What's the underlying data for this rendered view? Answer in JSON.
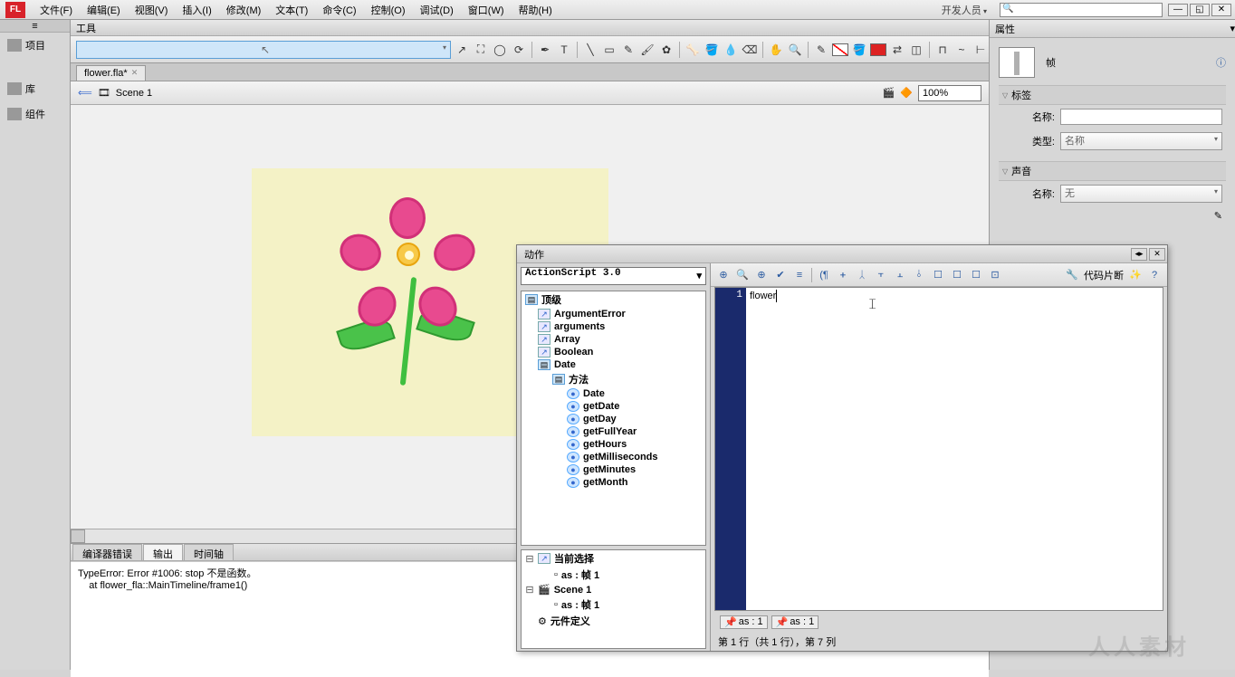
{
  "app": {
    "logo": "FL"
  },
  "menu": {
    "items": [
      "文件(F)",
      "编辑(E)",
      "视图(V)",
      "插入(I)",
      "修改(M)",
      "文本(T)",
      "命令(C)",
      "控制(O)",
      "调试(D)",
      "窗口(W)",
      "帮助(H)"
    ],
    "dev": "开发人员",
    "search": ""
  },
  "leftPanel": {
    "items": [
      "项目",
      "库",
      "组件"
    ]
  },
  "tools": {
    "title": "工具"
  },
  "doc": {
    "tab": "flower.fla*",
    "scene": "Scene 1",
    "zoom": "100%"
  },
  "bottom": {
    "tabs": [
      "编译器错误",
      "输出",
      "时间轴"
    ],
    "active": 1,
    "out1": "TypeError: Error #1006: stop 不是函数。",
    "out2": "    at flower_fla::MainTimeline/frame1()"
  },
  "props": {
    "title": "属性",
    "frame": "帧",
    "sec_label": "标签",
    "label_name": "名称:",
    "label_type": "类型:",
    "type_val": "名称",
    "sec_sound": "声音",
    "sound_name": "名称:",
    "sound_val": "无",
    "pencil_row": "✎"
  },
  "actions": {
    "title": "动作",
    "lang": "ActionScript 3.0",
    "tree": {
      "top": "顶级",
      "items": [
        "ArgumentError",
        "arguments",
        "Array",
        "Boolean",
        "Date"
      ],
      "methods_h": "方法",
      "methods": [
        "Date",
        "getDate",
        "getDay",
        "getFullYear",
        "getHours",
        "getMilliseconds",
        "getMinutes",
        "getMonth"
      ]
    },
    "lower": {
      "sel": "当前选择",
      "sel_item": "as : 帧 1",
      "scene": "Scene 1",
      "scene_item": "as : 帧 1",
      "symdef": "元件定义"
    },
    "snippets": "代码片断",
    "code": "flower",
    "footer": {
      "b1": "as : 1",
      "b2": "as : 1"
    },
    "status": "第 1 行（共 1 行），第 7 列"
  },
  "watermark": "人人素材"
}
